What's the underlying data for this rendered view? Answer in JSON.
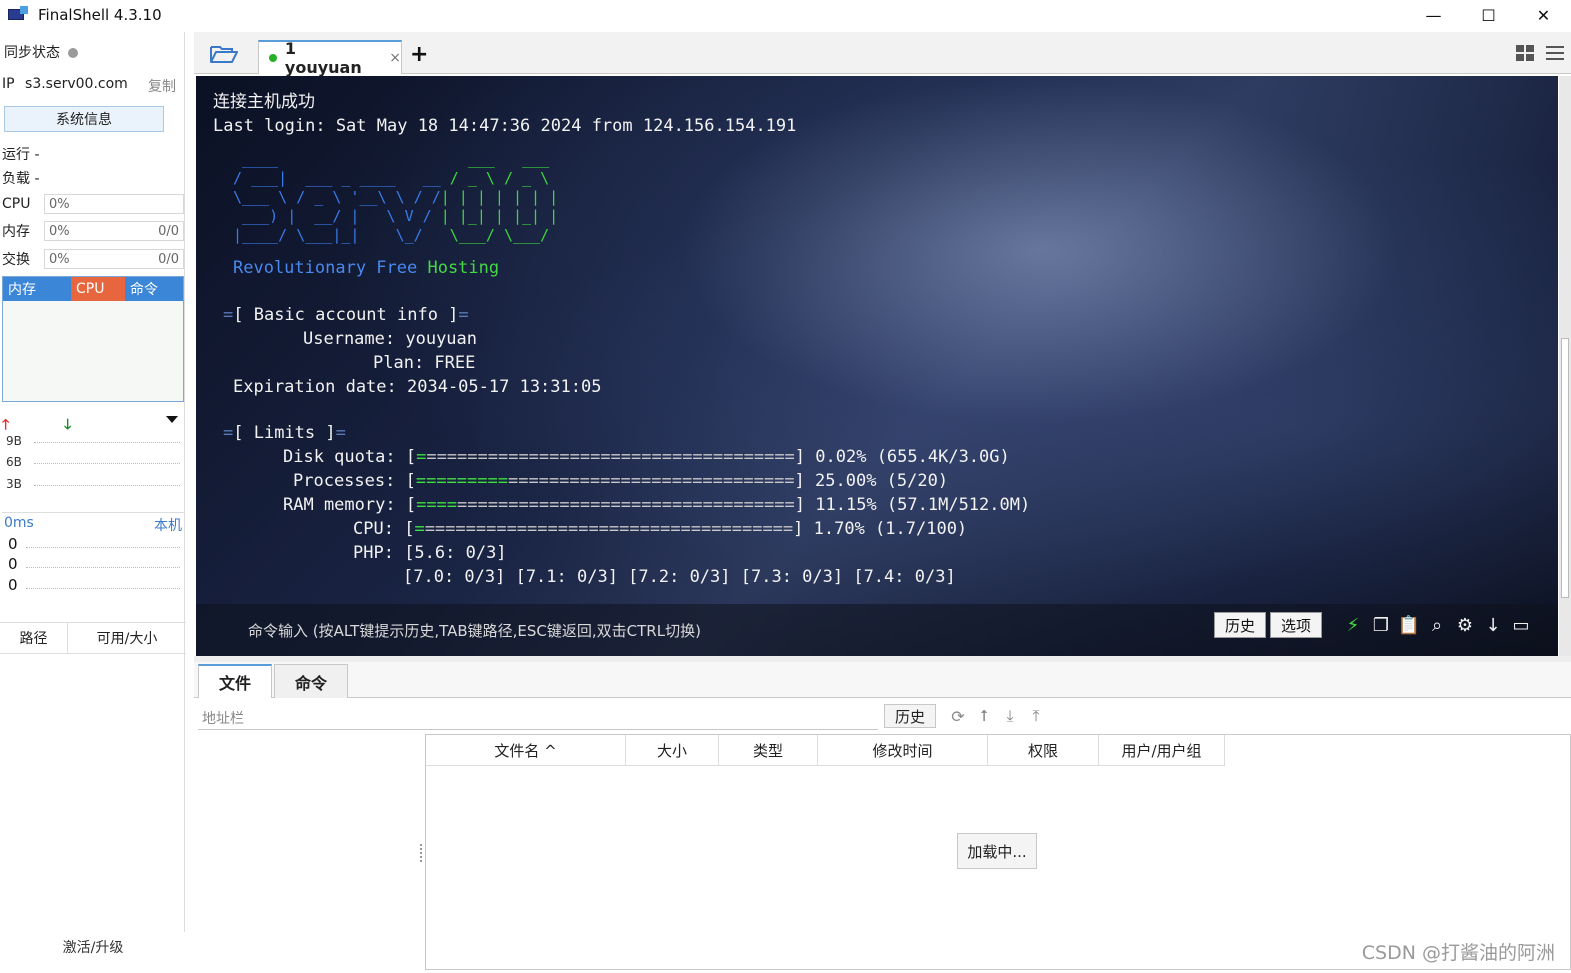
{
  "window": {
    "title": "FinalShell 4.3.10",
    "minimize": "—",
    "maximize": "☐",
    "close": "✕"
  },
  "sidebar": {
    "sync_label": "同步状态",
    "ip_label": "IP",
    "ip_value": "s3.serv00.com",
    "copy": "复制",
    "sysinfo_button": "系统信息",
    "run_label": "运行 -",
    "load_label": "负载 -",
    "cpu": {
      "label": "CPU",
      "value": "0%"
    },
    "mem": {
      "label": "内存",
      "value": "0%",
      "extra": "0/0"
    },
    "swap": {
      "label": "交换",
      "value": "0%",
      "extra": "0/0"
    },
    "monitor_tabs": [
      "内存",
      "CPU",
      "命令"
    ],
    "net_labels": [
      "9B",
      "6B",
      "3B"
    ],
    "ping_ms": "0ms",
    "ping_host": "本机",
    "ping_values": [
      "0",
      "0",
      "0"
    ],
    "path_col": "路径",
    "avail_col": "可用/大小",
    "activate": "激活/升级"
  },
  "tabs": {
    "session_label": "1 youyuan",
    "close": "×",
    "add": "+"
  },
  "terminal": {
    "line1": "连接主机成功",
    "line2": "Last login: Sat May 18 14:47:36 2024 from 124.156.154.191",
    "tagline_blue": "Revolutionary Free ",
    "tagline_green": "Hosting",
    "basic_header": "[ Basic account info ]",
    "username_label": "Username: ",
    "username_value": "youyuan",
    "plan_label": "Plan: ",
    "plan_value": "FREE",
    "expiration_label": "Expiration date: ",
    "expiration_value": "2034-05-17 13:31:05",
    "limits_header": "[ Limits ]",
    "disk_label": "Disk quota: ",
    "disk_value": "0.02% (655.4K/3.0G)",
    "proc_label": "Processes: ",
    "proc_value": "25.00% (5/20)",
    "ram_label": "RAM memory: ",
    "ram_value": "11.15% (57.1M/512.0M)",
    "cpu_label": "CPU: ",
    "cpu_value": "1.70% (1.7/100)",
    "php_label": "PHP: ",
    "php_line1": "[5.6: 0/3]",
    "php_line2": "[7.0: 0/3] [7.1: 0/3] [7.2: 0/3] [7.3: 0/3] [7.4: 0/3]",
    "disk_fraction": 0.0002,
    "proc_fraction": 0.25,
    "ram_fraction": 0.1115,
    "cpu_fraction": 0.017,
    "cmd_hint": "命令输入 (按ALT键提示历史,TAB键路径,ESC键返回,双击CTRL切换)",
    "history_button": "历史",
    "options_button": "选项"
  },
  "files": {
    "tab_files": "文件",
    "tab_commands": "命令",
    "address_placeholder": "地址栏",
    "history_button": "历史",
    "columns": [
      "文件名 ^",
      "大小",
      "类型",
      "修改时间",
      "权限",
      "用户/用户组"
    ],
    "loading": "加载中..."
  },
  "watermark": "CSDN @打酱油的阿洲"
}
